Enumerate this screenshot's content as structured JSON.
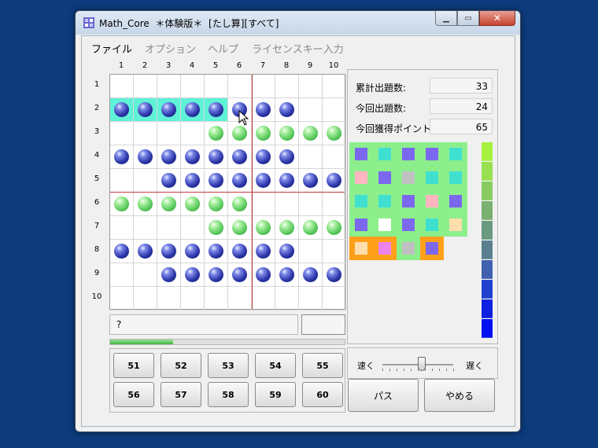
{
  "window": {
    "title": "Math_Core  ＊体験版＊  [たし算][すべて]"
  },
  "menu": [
    "ファイル",
    "オプション",
    "ヘルプ",
    "ライセンスキー入力"
  ],
  "board": {
    "columns": [
      "1",
      "2",
      "3",
      "4",
      "5",
      "6",
      "7",
      "8",
      "9",
      "10"
    ],
    "rows": [
      "1",
      "2",
      "3",
      "4",
      "5",
      "6",
      "7",
      "8",
      "9",
      "10"
    ],
    "cells": [
      "..........",
      "BBBBBBBB..",
      "....GGGGGG",
      "BBBBBBBB..",
      "..BBBBBBBB",
      "GGGGGG....",
      "....GGGGGG",
      "BBBBBBBB..",
      "..BBBBBBBB",
      ".........."
    ],
    "highlight_row": 2,
    "highlight_cols": 5
  },
  "question": {
    "text": "?",
    "answer": ""
  },
  "progress": {
    "value": 0.27
  },
  "choices": [
    "51",
    "52",
    "53",
    "54",
    "55",
    "56",
    "57",
    "58",
    "59",
    "60"
  ],
  "stats": [
    {
      "label": "累計出題数:",
      "value": "33"
    },
    {
      "label": "今回出題数:",
      "value": "24"
    },
    {
      "label": "今回獲得ポイント:",
      "value": "65"
    }
  ],
  "rewards": [
    [
      "#7b68ee",
      "#40e0d0",
      "#7b68ee",
      "#7b68ee",
      "#40e0d0"
    ],
    [
      "#ffb6c1",
      "#7b68ee",
      "#c0c0c0",
      "#40e0d0",
      "#40e0d0"
    ],
    [
      "#40e0d0",
      "#40e0d0",
      "#7b68ee",
      "#ffb6c1",
      "#7b68ee"
    ],
    [
      "#7b68ee",
      "#ffffff",
      "#7b68ee",
      "#40e0d0",
      "#ffdead"
    ],
    [
      "#ffdead",
      "#ee82ee",
      "#c0c0c0",
      "#7b68ee",
      ""
    ]
  ],
  "speed": {
    "fast_label": "速く",
    "slow_label": "遅く",
    "value": 0.55
  },
  "buttons": {
    "pass": "パス",
    "quit": "やめる"
  },
  "colors": {
    "accent_cyan": "#5ff2d7",
    "reward_green": "#8cef8c",
    "reward_orange": "#ff9f1a"
  }
}
